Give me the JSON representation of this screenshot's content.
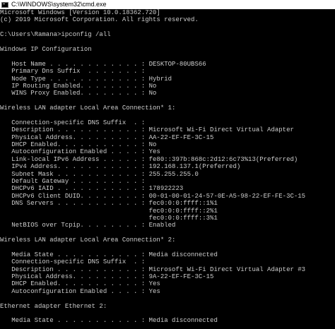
{
  "window": {
    "title": "C:\\WINDOWS\\system32\\cmd.exe",
    "icon": "cmd-icon"
  },
  "colors": {
    "background": "#000000",
    "foreground": "#cccccc",
    "titlebar": "#ffffff"
  },
  "console": {
    "lines": [
      "Microsoft Windows [Version 10.0.18362.720]",
      "(c) 2019 Microsoft Corporation. All rights reserved.",
      "",
      "C:\\Users\\Ramana>ipconfig /all",
      "",
      "Windows IP Configuration",
      "",
      "   Host Name . . . . . . . . . . . . : DESKTOP-80UBS66",
      "   Primary Dns Suffix  . . . . . . . :",
      "   Node Type . . . . . . . . . . . . : Hybrid",
      "   IP Routing Enabled. . . . . . . . : No",
      "   WINS Proxy Enabled. . . . . . . . : No",
      "",
      "Wireless LAN adapter Local Area Connection* 1:",
      "",
      "   Connection-specific DNS Suffix  . :",
      "   Description . . . . . . . . . . . : Microsoft Wi-Fi Direct Virtual Adapter",
      "   Physical Address. . . . . . . . . : AA-22-EF-FE-3C-15",
      "   DHCP Enabled. . . . . . . . . . . : No",
      "   Autoconfiguration Enabled . . . . : Yes",
      "   Link-local IPv6 Address . . . . . : fe80::397b:868c:2d12:6c73%13(Preferred)",
      "   IPv4 Address. . . . . . . . . . . : 192.168.137.1(Preferred)",
      "   Subnet Mask . . . . . . . . . . . : 255.255.255.0",
      "   Default Gateway . . . . . . . . . :",
      "   DHCPv6 IAID . . . . . . . . . . . : 178922223",
      "   DHCPv6 Client DUID. . . . . . . . : 00-01-00-01-24-57-0E-A5-98-22-EF-FE-3C-15",
      "   DNS Servers . . . . . . . . . . . : fec0:0:0:ffff::1%1",
      "                                       fec0:0:0:ffff::2%1",
      "                                       fec0:0:0:ffff::3%1",
      "   NetBIOS over Tcpip. . . . . . . . : Enabled",
      "",
      "Wireless LAN adapter Local Area Connection* 2:",
      "",
      "   Media State . . . . . . . . . . . : Media disconnected",
      "   Connection-specific DNS Suffix  . :",
      "   Description . . . . . . . . . . . : Microsoft Wi-Fi Direct Virtual Adapter #3",
      "   Physical Address. . . . . . . . . : 9A-22-EF-FE-3C-15",
      "   DHCP Enabled. . . . . . . . . . . : Yes",
      "   Autoconfiguration Enabled . . . . : Yes",
      "",
      "Ethernet adapter Ethernet 2:",
      "",
      "   Media State . . . . . . . . . . . : Media disconnected"
    ]
  }
}
